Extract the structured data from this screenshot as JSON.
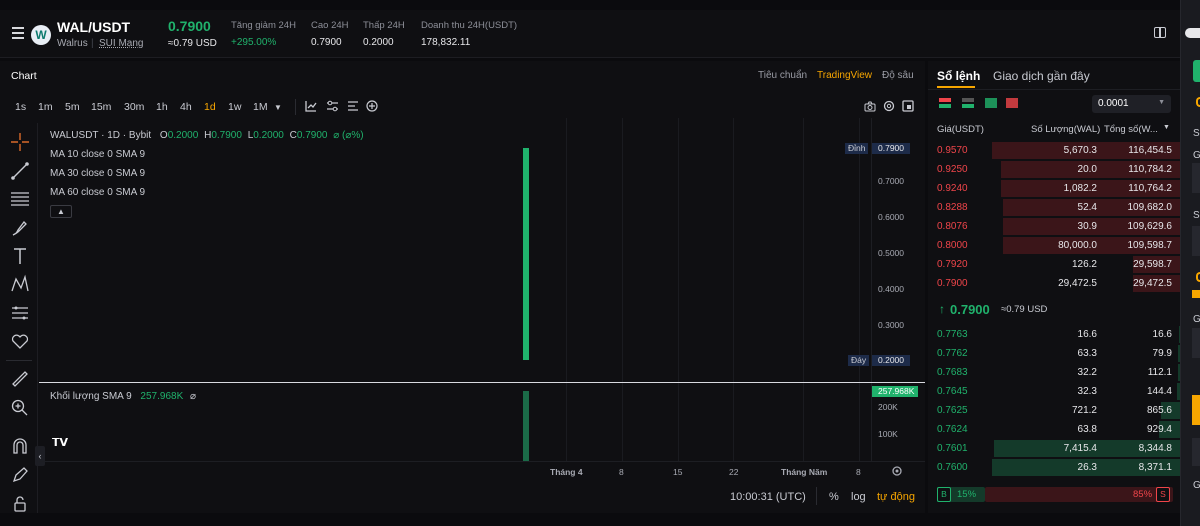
{
  "header": {
    "pair": "WAL/USDT",
    "coin_name": "Walrus",
    "network": "SUI Mạng",
    "last_price": "0.7900",
    "last_price_usd": "≈0.79 USD",
    "stats": [
      {
        "label": "Tăng giảm 24H",
        "value": "+295.00%"
      },
      {
        "label": "Cao 24H",
        "value": "0.7900"
      },
      {
        "label": "Thấp 24H",
        "value": "0.2000"
      },
      {
        "label": "Doanh thu 24H(USDT)",
        "value": "178,832.11"
      }
    ]
  },
  "chart_panel": {
    "title": "Chart",
    "views": [
      "Tiêu chuẩn",
      "TradingView",
      "Độ sâu"
    ],
    "active_view": "TradingView",
    "timeframes": [
      "1s",
      "1m",
      "5m",
      "15m",
      "30m",
      "1h",
      "4h",
      "1d",
      "1w",
      "1M"
    ],
    "active_timeframe": "1d",
    "legend": {
      "symbol": "WALUSDT · 1D · Bybit",
      "o_label": "O",
      "o": "0.2000",
      "h_label": "H",
      "h": "0.7900",
      "l_label": "L",
      "l": "0.2000",
      "c_label": "C",
      "c": "0.7900",
      "chg": "⌀ (⌀%)"
    },
    "ma_lines": [
      "MA 10 close 0 SMA 9",
      "MA 30 close 0 SMA 9",
      "MA 60 close 0 SMA 9"
    ],
    "volume_label": "Khối lượng SMA 9",
    "volume_value": "257.968K",
    "volume_extra": "⌀",
    "time": "10:00:31 (UTC)",
    "bottom_options": [
      "%",
      "log",
      "tự động"
    ]
  },
  "chart_data": {
    "type": "candlestick",
    "candles": [
      {
        "time": "Tháng 4",
        "open": 0.2,
        "high": 0.79,
        "low": 0.2,
        "close": 0.79,
        "volume": 257968
      }
    ],
    "y_ticks": [
      "0.7000",
      "0.6000",
      "0.5000",
      "0.4000",
      "0.3000"
    ],
    "ylim": [
      0.2,
      0.79
    ],
    "high_tag": {
      "label": "Đỉnh",
      "value": "0.7900"
    },
    "low_tag": {
      "label": "Đáy",
      "value": "0.2000"
    },
    "volume_ticks": [
      "200K",
      "100K"
    ],
    "volume_tag": "257.968K",
    "x_ticks": [
      "Tháng 4",
      "8",
      "15",
      "22",
      "Tháng Năm",
      "8"
    ],
    "colors": {
      "up": "#20b26c",
      "volume_up": "#1b6b48"
    }
  },
  "orderbook": {
    "tabs": [
      "Sổ lệnh",
      "Giao dịch gần đây"
    ],
    "precision": "0.0001",
    "headers": [
      "Giá(USDT)",
      "Số Lượng(WAL)",
      "Tổng số(W..."
    ],
    "asks": [
      {
        "price": "0.9570",
        "qty": "5,670.3",
        "total": "116,454.5"
      },
      {
        "price": "0.9250",
        "qty": "20.0",
        "total": "110,784.2"
      },
      {
        "price": "0.9240",
        "qty": "1,082.2",
        "total": "110,764.2"
      },
      {
        "price": "0.8288",
        "qty": "52.4",
        "total": "109,682.0"
      },
      {
        "price": "0.8076",
        "qty": "30.9",
        "total": "109,629.6"
      },
      {
        "price": "0.8000",
        "qty": "80,000.0",
        "total": "109,598.7"
      },
      {
        "price": "0.7920",
        "qty": "126.2",
        "total": "29,598.7"
      },
      {
        "price": "0.7900",
        "qty": "29,472.5",
        "total": "29,472.5"
      }
    ],
    "mid_price": "0.7900",
    "mid_usd": "≈0.79 USD",
    "bids": [
      {
        "price": "0.7763",
        "qty": "16.6",
        "total": "16.6"
      },
      {
        "price": "0.7762",
        "qty": "63.3",
        "total": "79.9"
      },
      {
        "price": "0.7683",
        "qty": "32.2",
        "total": "112.1"
      },
      {
        "price": "0.7645",
        "qty": "32.3",
        "total": "144.4"
      },
      {
        "price": "0.7625",
        "qty": "721.2",
        "total": "865.6"
      },
      {
        "price": "0.7624",
        "qty": "63.8",
        "total": "929.4"
      },
      {
        "price": "0.7601",
        "qty": "7,415.4",
        "total": "8,344.8"
      },
      {
        "price": "0.7600",
        "qty": "26.3",
        "total": "8,371.1"
      }
    ],
    "ask_depth_fractions": [
      1.0,
      0.95,
      0.95,
      0.94,
      0.94,
      0.94,
      0.25,
      0.25
    ],
    "bid_depth_fractions": [
      0.002,
      0.01,
      0.013,
      0.017,
      0.1,
      0.11,
      0.99,
      1.0
    ],
    "buy_label": "B",
    "buy_pct": "15%",
    "sell_pct": "85%",
    "sell_label": "S",
    "buy_fraction": 0.15
  },
  "right_edge": {
    "letters": [
      "S",
      "G",
      "S",
      "G",
      "G"
    ]
  }
}
